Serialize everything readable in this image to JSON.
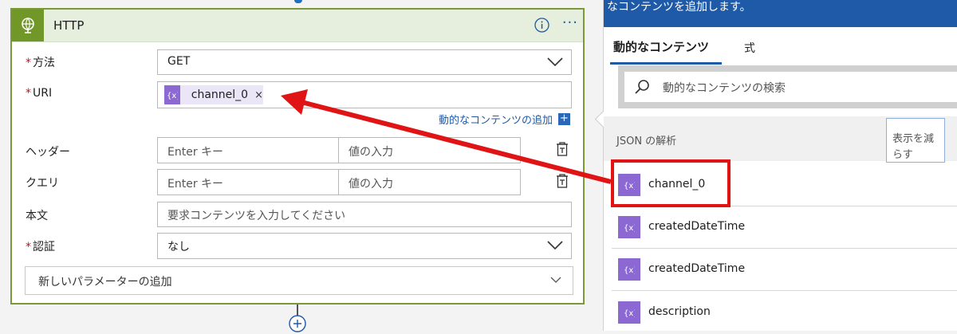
{
  "action": {
    "title": "HTTP",
    "fields": {
      "method": {
        "label": "方法",
        "value": "GET"
      },
      "uri": {
        "label": "URI",
        "token": "channel_0",
        "remove": "×"
      },
      "add_dynamic": "動的なコンテンツの追加",
      "headers": {
        "label": "ヘッダー",
        "key_placeholder": "Enter キー",
        "value_placeholder": "値の入力"
      },
      "queries": {
        "label": "クエリ",
        "key_placeholder": "Enter キー",
        "value_placeholder": "値の入力"
      },
      "body": {
        "label": "本文",
        "placeholder": "要求コンテンツを入力してください"
      },
      "auth": {
        "label": "認証",
        "value": "なし"
      }
    },
    "add_parameter": "新しいパラメーターの追加",
    "more": "···",
    "required_mark": "*"
  },
  "panel": {
    "banner": "なコンテンツを追加します。",
    "tabs": {
      "dynamic": "動的なコンテンツ",
      "expression": "式"
    },
    "search_placeholder": "動的なコンテンツの検索",
    "section": "JSON の解析",
    "show_less": "表示を減らす",
    "items": [
      "channel_0",
      "createdDateTime",
      "createdDateTime",
      "description"
    ]
  },
  "colors": {
    "accent": "#1f5aa8",
    "token": "#8c68d3",
    "card_border": "#7a9a3a",
    "highlight": "#e01414"
  }
}
